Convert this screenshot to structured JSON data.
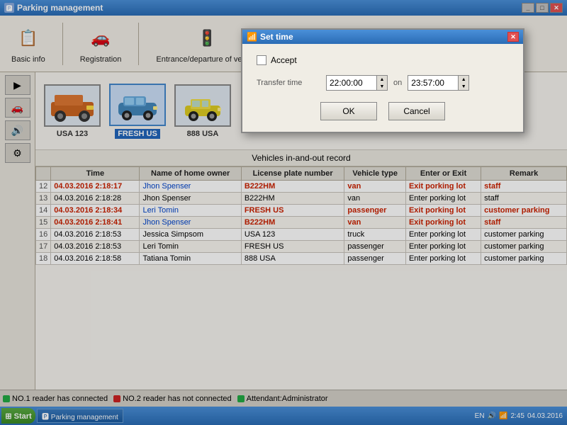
{
  "window": {
    "title": "Parking management",
    "icon": "🅿"
  },
  "toolbar": {
    "items": [
      {
        "id": "basic-info",
        "label": "Basic info",
        "icon": "📋"
      },
      {
        "id": "registration",
        "label": "Registration",
        "icon": "🚗"
      },
      {
        "id": "entrance-departure",
        "label": "Entrance/departure of vehicle",
        "icon": "🚦"
      }
    ]
  },
  "sidebar": {
    "buttons": [
      {
        "icon": "▶",
        "label": "forward"
      },
      {
        "icon": "🚗",
        "label": "vehicle"
      },
      {
        "icon": "🔊",
        "label": "sound"
      },
      {
        "icon": "⚙",
        "label": "settings"
      }
    ]
  },
  "vehicles": [
    {
      "id": "usa123",
      "label": "USA 123",
      "icon": "🚛",
      "selected": false
    },
    {
      "id": "freshus",
      "label": "FRESH US",
      "icon": "🚙",
      "selected": true
    },
    {
      "id": "888usa",
      "label": "888 USA",
      "icon": "🏎",
      "selected": false
    }
  ],
  "table": {
    "title": "Vehicles in-and-out record",
    "columns": [
      "Time",
      "Name of home owner",
      "License plate number",
      "Vehicle type",
      "Enter or Exit",
      "Remark"
    ],
    "rows": [
      {
        "num": "12",
        "time": "04.03.2016 2:18:17",
        "owner": "Jhon Spenser",
        "plate": "B222HM",
        "type": "van",
        "action": "Exit porking lot",
        "remark": "staff",
        "highlight": true
      },
      {
        "num": "13",
        "time": "04.03.2016 2:18:28",
        "owner": "Jhon Spenser",
        "plate": "B222HM",
        "type": "van",
        "action": "Enter porking lot",
        "remark": "staff",
        "highlight": false
      },
      {
        "num": "14",
        "time": "04.03.2016 2:18:34",
        "owner": "Leri Tomin",
        "plate": "FRESH US",
        "type": "passenger",
        "action": "Exit porking lot",
        "remark": "customer parking",
        "highlight": true
      },
      {
        "num": "15",
        "time": "04.03.2016 2:18:41",
        "owner": "Jhon Spenser",
        "plate": "B222HM",
        "type": "van",
        "action": "Exit porking lot",
        "remark": "staff",
        "highlight": true
      },
      {
        "num": "16",
        "time": "04.03.2016 2:18:53",
        "owner": "Jessica Simpsom",
        "plate": "USA 123",
        "type": "truck",
        "action": "Enter porking lot",
        "remark": "customer parking",
        "highlight": false
      },
      {
        "num": "17",
        "time": "04.03.2016 2:18:53",
        "owner": "Leri Tomin",
        "plate": "FRESH US",
        "type": "passenger",
        "action": "Enter porking lot",
        "remark": "customer parking",
        "highlight": false
      },
      {
        "num": "18",
        "time": "04.03.2016 2:18:58",
        "owner": "Tatiana Tomin",
        "plate": "888 USA",
        "type": "passenger",
        "action": "Enter porking lot",
        "remark": "customer parking",
        "highlight": false
      }
    ]
  },
  "modal": {
    "title": "Set time",
    "accept_label": "Accept",
    "transfer_time_label": "Transfer time",
    "transfer_time_value": "22:00:00",
    "on_label": "on",
    "on_time_value": "23:57:00",
    "ok_label": "OK",
    "cancel_label": "Cancel"
  },
  "status": {
    "reader1": "NO.1 reader has connected",
    "reader2": "NO.2 reader has not connected",
    "attendant": "Attendant:Administrator"
  },
  "taskbar": {
    "time": "2:45",
    "date": "04.03.2016",
    "lang": "EN"
  }
}
